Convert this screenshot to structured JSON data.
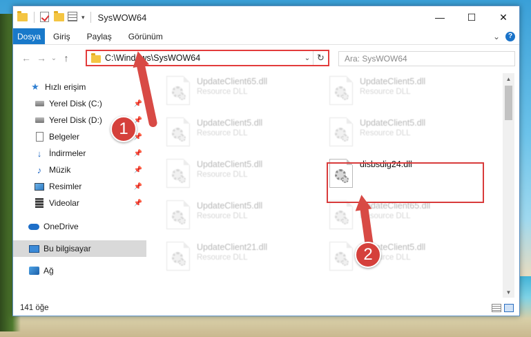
{
  "window": {
    "title": "SysWOW64",
    "minimize": "—",
    "maximize": "☐",
    "close": "✕"
  },
  "ribbon": {
    "tabs": [
      "Dosya",
      "Giriş",
      "Paylaş",
      "Görünüm"
    ],
    "expand": "⌄",
    "help": "?"
  },
  "nav": {
    "back": "←",
    "forward": "→",
    "recent": "⌄",
    "up": "↑",
    "address": "C:\\Windows\\SysWOW64",
    "address_drop": "⌄",
    "refresh": "↻",
    "search_placeholder": "Ara: SysWOW64"
  },
  "sidebar": {
    "items": [
      {
        "label": "Hızlı erişim",
        "icon": "star-icon"
      },
      {
        "label": "Yerel Disk (C:)",
        "icon": "drive-icon",
        "pinned": true
      },
      {
        "label": "Yerel Disk (D:)",
        "icon": "drive-icon",
        "pinned": true
      },
      {
        "label": "Belgeler",
        "icon": "document-icon",
        "pinned": true
      },
      {
        "label": "İndirmeler",
        "icon": "download-icon",
        "pinned": true
      },
      {
        "label": "Müzik",
        "icon": "music-icon",
        "pinned": true
      },
      {
        "label": "Resimler",
        "icon": "pictures-icon",
        "pinned": true
      },
      {
        "label": "Videolar",
        "icon": "videos-icon",
        "pinned": true
      },
      {
        "label": "OneDrive",
        "icon": "onedrive-icon"
      },
      {
        "label": "Bu bilgisayar",
        "icon": "this-pc-icon",
        "selected": true
      },
      {
        "label": "Ağ",
        "icon": "network-icon"
      }
    ],
    "pin_glyph": "📌"
  },
  "files": [
    {
      "name": "UpdateClient65.dll",
      "type": "Resource DLL",
      "dim": true
    },
    {
      "name": "UpdateClient5.dll",
      "type": "Resource DLL",
      "dim": true
    },
    {
      "name": "UpdateClient5.dll",
      "type": "Resource DLL",
      "dim": true
    },
    {
      "name": "UpdateClient5.dll",
      "type": "Resource DLL",
      "dim": true
    },
    {
      "name": "UpdateClient5.dll",
      "type": "Resource DLL",
      "dim": true
    },
    {
      "name": "disbsdig24.dll",
      "type": "",
      "dim": false
    },
    {
      "name": "UpdateClient5.dll",
      "type": "Resource DLL",
      "dim": true
    },
    {
      "name": "UpdateClient65.dll",
      "type": "Resource DLL",
      "dim": true
    },
    {
      "name": "UpdateClient21.dll",
      "type": "Resource DLL",
      "dim": true
    },
    {
      "name": "UpdateClient5.dll",
      "type": "Resource DLL",
      "dim": true
    }
  ],
  "status": {
    "count": "141 öğe"
  },
  "annotations": {
    "step1": "1",
    "step2": "2",
    "color": "#d5403b"
  },
  "scrollbar": {
    "up": "▲",
    "down": "▼"
  }
}
